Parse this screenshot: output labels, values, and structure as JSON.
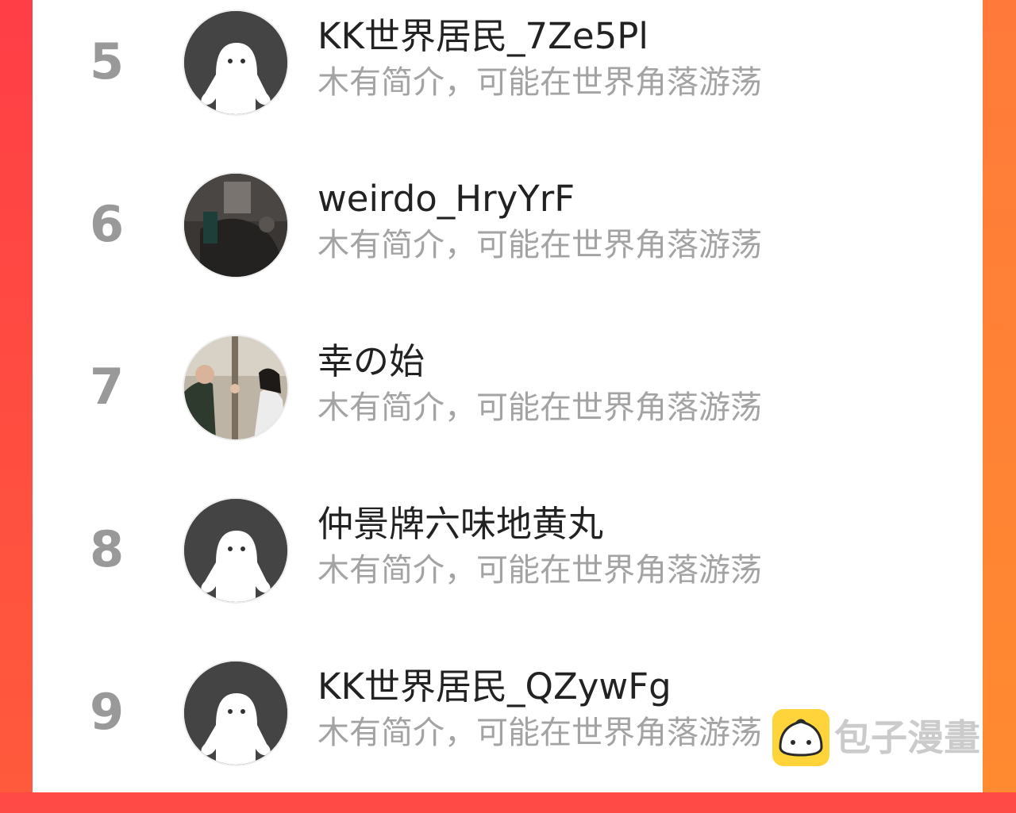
{
  "users": [
    {
      "rank": "5",
      "name": "KK世界居民_7Ze5Pl",
      "bio": "木有简介，可能在世界角落游荡",
      "avatar": "default-avatar-icon"
    },
    {
      "rank": "6",
      "name": "weirdo_HryYrF",
      "bio": "木有简介，可能在世界角落游荡",
      "avatar": "photo-avatar"
    },
    {
      "rank": "7",
      "name": "幸の始",
      "bio": "木有简介，可能在世界角落游荡",
      "avatar": "photo-avatar"
    },
    {
      "rank": "8",
      "name": "仲景牌六味地黄丸",
      "bio": "木有简介，可能在世界角落游荡",
      "avatar": "default-avatar-icon"
    },
    {
      "rank": "9",
      "name": "KK世界居民_QZywFg",
      "bio": "木有简介，可能在世界角落游荡",
      "avatar": "default-avatar-icon"
    }
  ],
  "watermark": {
    "text": "包子漫畫",
    "icon": "bun-mascot-icon"
  },
  "colors": {
    "accent_left": "#ff4a45",
    "accent_right": "#ff7a3a",
    "rank": "#999999",
    "name": "#222222",
    "bio": "#a3a3a3"
  }
}
